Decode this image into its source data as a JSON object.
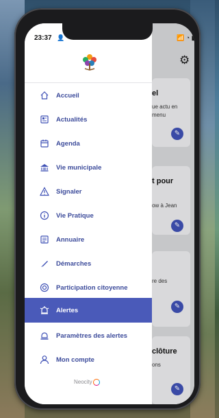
{
  "status": {
    "time": "23:37",
    "right": "📶 ◔ ▮"
  },
  "menu": {
    "items": [
      {
        "label": "Accueil",
        "icon": "home-icon"
      },
      {
        "label": "Actualités",
        "icon": "news-icon"
      },
      {
        "label": "Agenda",
        "icon": "calendar-icon"
      },
      {
        "label": "Vie municipale",
        "icon": "town-hall-icon"
      },
      {
        "label": "Signaler",
        "icon": "warning-icon"
      },
      {
        "label": "Vie Pratique",
        "icon": "info-icon"
      },
      {
        "label": "Annuaire",
        "icon": "directory-icon"
      },
      {
        "label": "Démarches",
        "icon": "pen-icon"
      },
      {
        "label": "Participation citoyenne",
        "icon": "chat-icon"
      },
      {
        "label": "Alertes",
        "icon": "alarm-icon",
        "active": true
      },
      {
        "label": "Paramètres des alertes",
        "icon": "alert-settings-icon"
      },
      {
        "label": "Mon compte",
        "icon": "user-icon"
      }
    ]
  },
  "brand": {
    "name": "Neocity"
  },
  "background_cards": [
    {
      "title": "el",
      "desc": [
        "ue actu en",
        "menu"
      ]
    },
    {
      "title": "t pour",
      "desc": [
        "ow à Jean"
      ]
    },
    {
      "title": "",
      "desc": [
        "re des"
      ]
    },
    {
      "title": "clôture",
      "desc": [
        "ons"
      ]
    }
  ],
  "colors": {
    "accent": "#3f51b5",
    "active_bg": "#4a5ab9",
    "label": "#3b4a9a"
  }
}
